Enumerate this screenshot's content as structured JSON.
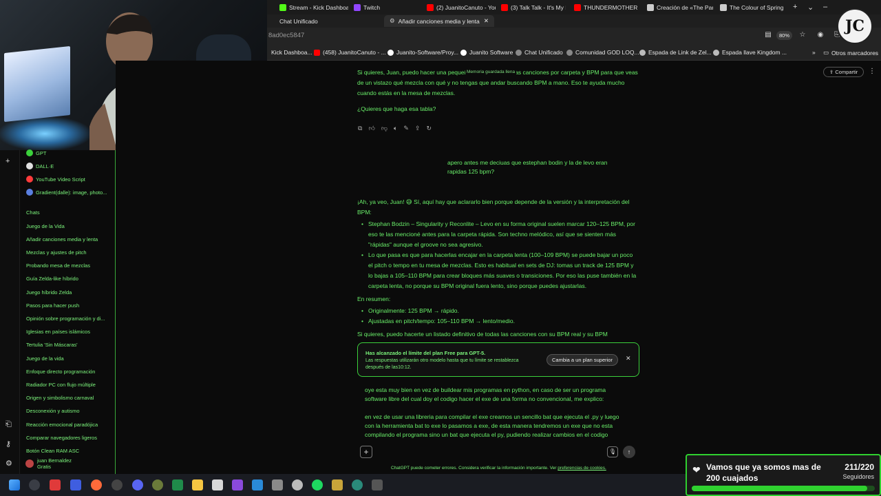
{
  "tabs_row1": [
    {
      "label": "Stream - Kick Dashboa...",
      "color": "#53fc18"
    },
    {
      "label": "Twitch",
      "color": "#9146ff"
    },
    {
      "label": "(2) JuanitoCanuto - You...",
      "color": "#ff0000"
    },
    {
      "label": "(3) Talk Talk - It's My L...",
      "color": "#ff0000"
    },
    {
      "label": "THUNDERMOTHER - It ...",
      "color": "#ff0000"
    },
    {
      "label": "Creación de «The Party...",
      "color": "#cccccc"
    },
    {
      "label": "The Colour of Spring - ...",
      "color": "#cccccc"
    }
  ],
  "tabs_row2": [
    {
      "label": "Chat Unificado"
    },
    {
      "label": "Añadir canciones media y lenta"
    }
  ],
  "address": {
    "url": "8ad0ec5847",
    "zoom": "80%"
  },
  "bookmarks": [
    {
      "label": "Kick Dashboa...",
      "color": "#53fc18"
    },
    {
      "label": "(458) JuanitoCanuto - ...",
      "color": "#ff0000"
    },
    {
      "label": "Juanito-Software/Proy...",
      "color": "#ffffff"
    },
    {
      "label": "Juanito Software",
      "color": "#ffffff"
    },
    {
      "label": "Chat Unificado",
      "color": "#cccccc"
    },
    {
      "label": "Comunidad GOD LOQ...",
      "color": "#cccccc"
    },
    {
      "label": "Espada de Link de Zel...",
      "color": "#cccccc"
    },
    {
      "label": "Espada llave Kingdom ...",
      "color": "#cccccc"
    }
  ],
  "bookmarks_more": "Otros marcadores",
  "sidebar": {
    "gpts": [
      {
        "label": "GPT",
        "color": "#3bd13b"
      },
      {
        "label": "DALL·E",
        "color": "#e0e0e0"
      },
      {
        "label": "YouTube Video Script",
        "color": "#ff3b3b"
      },
      {
        "label": "Gradient(dalle): image, photo...",
        "color": "#5a7fe0"
      }
    ],
    "chats_header": "Chats",
    "chats": [
      "Juego de la Vida",
      "Añadir canciones media y lenta",
      "Mezclas y ajustes de pitch",
      "Probando mesa de mezclas",
      "Guía Zelda-like híbrido",
      "Juego híbrido Zelda",
      "Pasos para hacer push",
      "Opinión sobre programación y di...",
      "Iglesias en países islámicos",
      "Tertulia 'Sin Máscaras'",
      "Juego de la vida",
      "Enfoque directo programación",
      "Radiador PC con flujo múltiple",
      "Origen y simbolismo carnaval",
      "Desconexión y autismo",
      "Reacción emocional paradójica",
      "Comparar navegadores ligeros",
      "Botón Clean RAM ASC"
    ],
    "user": {
      "name": "juan Bernaldez",
      "plan": "Gratis"
    }
  },
  "chat": {
    "share_label": "Compartir",
    "memory_tag": "Memoria guardada llena",
    "p1": "Si quieres, Juan, puedo hacer una pequeña tabla con todas las canciones por carpeta y BPM para que veas de un vistazo qué mezcla con qué y no tengas que andar buscando BPM a mano. Eso te ayuda mucho cuando estás en la mesa de mezclas.",
    "p2": "¿Quieres que haga esa tabla?",
    "user_msg": "apero antes me deciuas que estephan bodin y la de levo eran rapidas 125 bpm?",
    "r1": "¡Ah, ya veo, Juan! 😅 Sí, aquí hay que aclararlo bien porque depende de la versión y la interpretación del BPM:",
    "bullet1": "Stephan Bodzin – Singularity y Reconlite – Levo en su forma original suelen marcar 120–125 BPM, por eso te las mencioné antes para la carpeta rápida. Son techno melódico, así que se sienten más \"rápidas\" aunque el groove no sea agresivo.",
    "bullet2": "Lo que pasa es que para hacerlas encajar en la carpeta lenta (100–109 BPM) se puede bajar un poco el pitch o tempo en tu mesa de mezclas. Esto es habitual en sets de DJ: tomas un track de 125 BPM y lo bajas a 105–110 BPM para crear bloques más suaves o transiciones. Por eso las puse también en la carpeta lenta, no porque su BPM original fuera lento, sino porque puedes ajustarlas.",
    "summary_header": "En resumen:",
    "summary1": "Originalmente: 125 BPM → rápido.",
    "summary2": "Ajustadas en pitch/tempo: 105–110 BPM → lento/medio.",
    "p_last": "Si quieres, puedo hacerte un listado definitivo de todas las canciones con su BPM real y su BPM"
  },
  "limit_banner": {
    "title": "Has alcanzado el límite del plan Free para GPT-5.",
    "body": "Las respuestas utilizarán otro modelo hasta que tu límite se restablezca después de las10:12.",
    "button": "Cambia a un plan superior"
  },
  "draft": {
    "line1": "oye esta muy bien en vez de buildear mis programas en python, en caso de ser un programa software libre del cual doy el codigo hacer el exe de una forma no convencional, me explico:",
    "line2": "en vez de usar una libreria para compilar el exe creamos un sencillo bat que ejecuta el .py y luego con la herramienta bat to exe lo pasamos a exe, de esta manera tendremos un exe que no esta compilando el programa sino un bat que ejecuta el py, pudiendo realizar cambios en el codigo"
  },
  "footer": {
    "text": "ChatGPT puede cometer errores. Considera verificar la información importante. Ver ",
    "link": "preferencias de cookies."
  },
  "followers": {
    "title": "Vamos que ya somos mas de 200 cuajados",
    "count": "211/220",
    "label": "Seguidores",
    "progress": 0.959
  },
  "colors": {
    "accent": "#3bd13b",
    "text": "#6af06a",
    "bg": "#0b0b0b"
  }
}
